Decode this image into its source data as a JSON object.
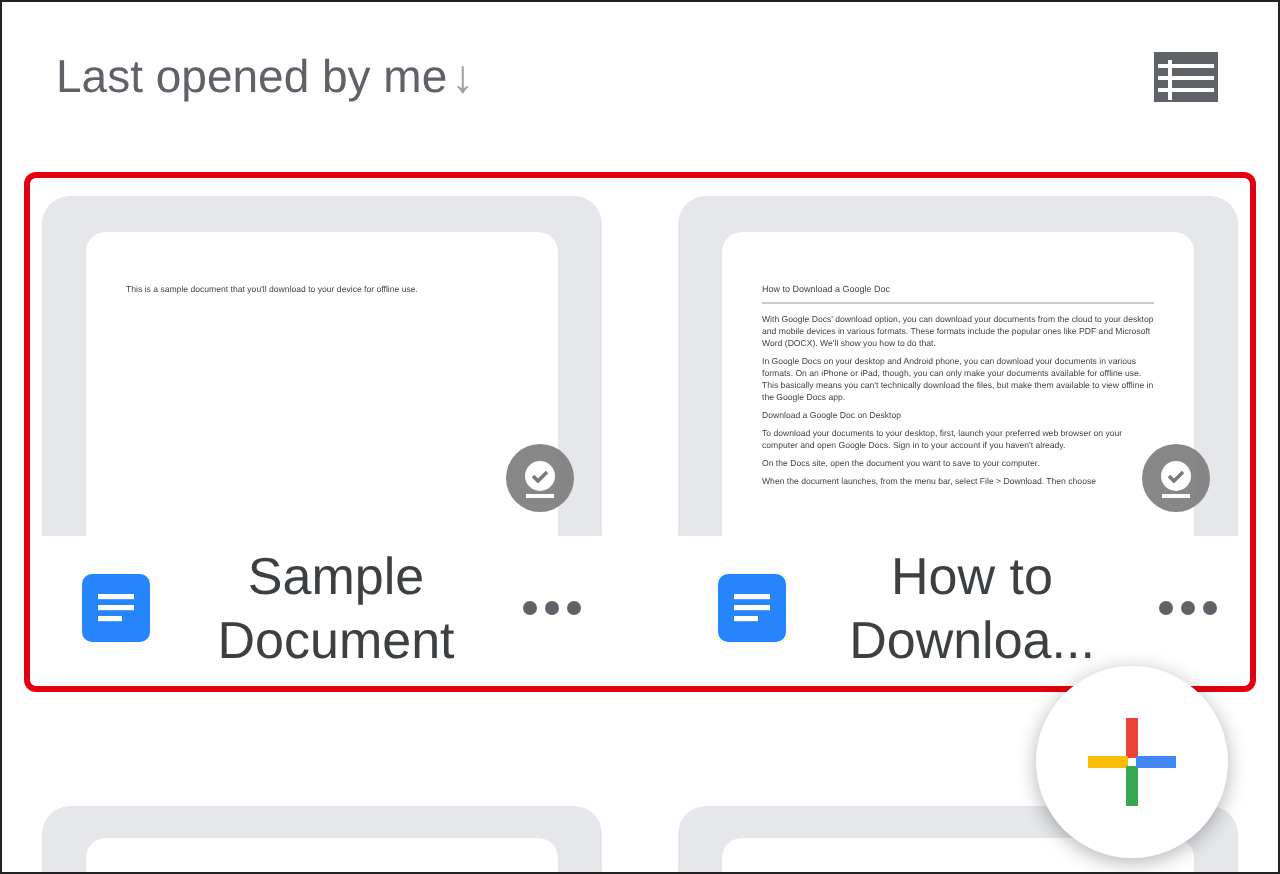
{
  "header": {
    "sort_label": "Last opened by me",
    "sort_arrow": "↓"
  },
  "files": [
    {
      "title": "Sample Document",
      "offline": true,
      "preview": [
        {
          "kind": "text",
          "text": "This is a sample document that you'll download to your device for offline use."
        }
      ]
    },
    {
      "title": "How to Downloa...",
      "offline": true,
      "preview": [
        {
          "kind": "title",
          "text": "How to Download a Google Doc"
        },
        {
          "kind": "text",
          "text": "With Google Docs' download option, you can download your documents from the cloud to your desktop and mobile devices in various formats. These formats include the popular ones like PDF and Microsoft Word (DOCX). We'll show you how to do that."
        },
        {
          "kind": "text",
          "text": "In Google Docs on your desktop and Android phone, you can download your documents in various formats. On an iPhone or iPad, though, you can only make your documents available for offline use. This basically means you can't technically download the files, but make them available to view offline in the Google Docs app."
        },
        {
          "kind": "text",
          "text": "Download a Google Doc on Desktop"
        },
        {
          "kind": "text",
          "text": "To download your documents to your desktop, first, launch your preferred web browser on your computer and open Google Docs. Sign in to your account if you haven't already."
        },
        {
          "kind": "text",
          "text": "On the Docs site, open the document you want to save to your computer."
        },
        {
          "kind": "text",
          "text": "When the document launches, from the menu bar, select File > Download. Then choose"
        }
      ]
    }
  ]
}
